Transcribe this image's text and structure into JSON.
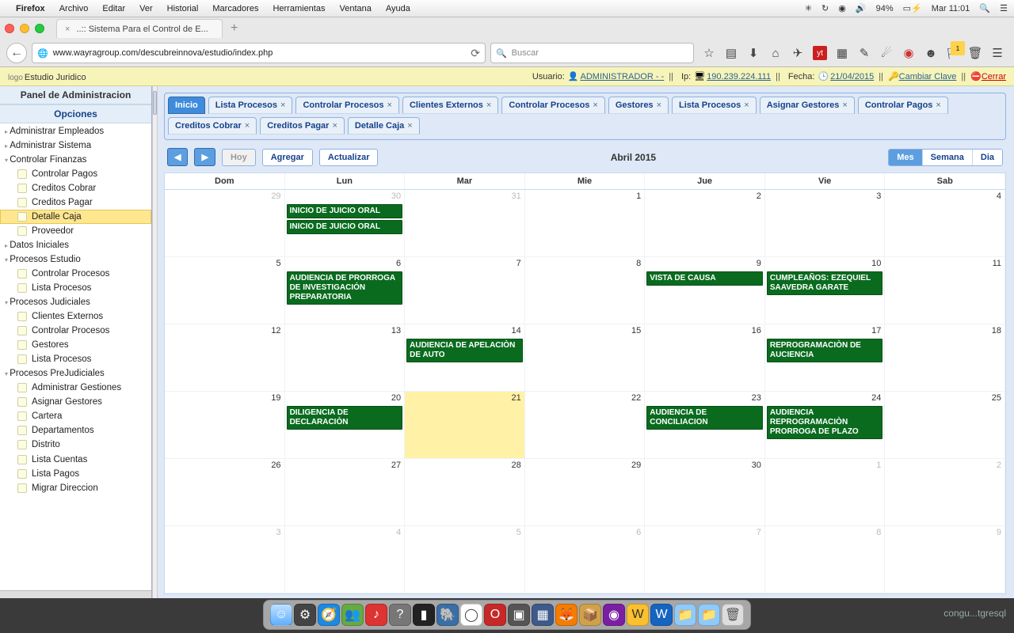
{
  "mac_menu": {
    "app": "Firefox",
    "items": [
      "Archivo",
      "Editar",
      "Ver",
      "Historial",
      "Marcadores",
      "Herramientas",
      "Ventana",
      "Ayuda"
    ],
    "status": {
      "battery": "94%",
      "time": "Mar 11:01"
    }
  },
  "browser": {
    "tab_title": "..:: Sistema Para el Control de E...",
    "url": "www.wayragroup.com/descubreinnova/estudio/index.php",
    "search_placeholder": "Buscar"
  },
  "app_header": {
    "logo_prefix": "logo",
    "logo_text": "Estudio Juridico",
    "usuario_label": "Usuario:",
    "usuario": "ADMINISTRADOR - -",
    "ip_label": "Ip:",
    "ip": "190.239.224.111",
    "fecha_label": "Fecha:",
    "fecha": "21/04/2015",
    "cambiar": "Cambiar Clave",
    "cerrar": "Cerrar"
  },
  "sidebar": {
    "title": "Panel de Administracion",
    "subtitle": "Opciones",
    "nodes": [
      {
        "label": "Administrar Empleados",
        "type": "parent",
        "open": false
      },
      {
        "label": "Administrar Sistema",
        "type": "parent",
        "open": false
      },
      {
        "label": "Controlar Finanzas",
        "type": "parent",
        "open": true
      },
      {
        "label": "Controlar Pagos",
        "type": "child"
      },
      {
        "label": "Creditos Cobrar",
        "type": "child"
      },
      {
        "label": "Creditos Pagar",
        "type": "child"
      },
      {
        "label": "Detalle Caja",
        "type": "child",
        "selected": true
      },
      {
        "label": "Proveedor",
        "type": "child"
      },
      {
        "label": "Datos Iniciales",
        "type": "parent",
        "open": false
      },
      {
        "label": "Procesos Estudio",
        "type": "parent",
        "open": true
      },
      {
        "label": "Controlar Procesos",
        "type": "child"
      },
      {
        "label": "Lista Procesos",
        "type": "child"
      },
      {
        "label": "Procesos Judiciales",
        "type": "parent",
        "open": true
      },
      {
        "label": "Clientes Externos",
        "type": "child"
      },
      {
        "label": "Controlar Procesos",
        "type": "child"
      },
      {
        "label": "Gestores",
        "type": "child"
      },
      {
        "label": "Lista Procesos",
        "type": "child"
      },
      {
        "label": "Procesos PreJudiciales",
        "type": "parent",
        "open": true
      },
      {
        "label": "Administrar Gestiones",
        "type": "child"
      },
      {
        "label": "Asignar Gestores",
        "type": "child"
      },
      {
        "label": "Cartera",
        "type": "child"
      },
      {
        "label": "Departamentos",
        "type": "child"
      },
      {
        "label": "Distrito",
        "type": "child"
      },
      {
        "label": "Lista Cuentas",
        "type": "child"
      },
      {
        "label": "Lista Pagos",
        "type": "child"
      },
      {
        "label": "Migrar Direccion",
        "type": "child"
      }
    ]
  },
  "tabs": [
    {
      "label": "Inicio",
      "active": true,
      "closable": false
    },
    {
      "label": "Lista Procesos",
      "closable": true
    },
    {
      "label": "Controlar Procesos",
      "closable": true
    },
    {
      "label": "Clientes Externos",
      "closable": true
    },
    {
      "label": "Controlar Procesos",
      "closable": true
    },
    {
      "label": "Gestores",
      "closable": true
    },
    {
      "label": "Lista Procesos",
      "closable": true
    },
    {
      "label": "Asignar Gestores",
      "closable": true
    },
    {
      "label": "Controlar Pagos",
      "closable": true
    },
    {
      "label": "Creditos Cobrar",
      "closable": true
    },
    {
      "label": "Creditos Pagar",
      "closable": true
    },
    {
      "label": "Detalle Caja",
      "closable": true
    }
  ],
  "calendar": {
    "toolbar": {
      "hoy": "Hoy",
      "agregar": "Agregar",
      "actualizar": "Actualizar"
    },
    "title": "Abril 2015",
    "views": {
      "mes": "Mes",
      "semana": "Semana",
      "dia": "Dia"
    },
    "dow": [
      "Dom",
      "Lun",
      "Mar",
      "Mie",
      "Jue",
      "Vie",
      "Sab"
    ],
    "weeks": [
      [
        {
          "n": "29",
          "other": true
        },
        {
          "n": "30",
          "other": true,
          "events": [
            "INICIO DE JUICIO ORAL",
            "INICIO DE JUICIO ORAL"
          ]
        },
        {
          "n": "31",
          "other": true
        },
        {
          "n": "1"
        },
        {
          "n": "2"
        },
        {
          "n": "3"
        },
        {
          "n": "4"
        }
      ],
      [
        {
          "n": "5"
        },
        {
          "n": "6",
          "events": [
            "AUDIENCIA DE PRORROGA DE INVESTIGACIÓN PREPARATORIA"
          ]
        },
        {
          "n": "7"
        },
        {
          "n": "8"
        },
        {
          "n": "9",
          "events": [
            "VISTA DE CAUSA"
          ]
        },
        {
          "n": "10",
          "events": [
            "CUMPLEAÑOS: EZEQUIEL SAAVEDRA GARATE"
          ]
        },
        {
          "n": "11"
        }
      ],
      [
        {
          "n": "12"
        },
        {
          "n": "13"
        },
        {
          "n": "14",
          "events": [
            "AUDIENCIA DE APELACIÒN DE AUTO"
          ]
        },
        {
          "n": "15"
        },
        {
          "n": "16"
        },
        {
          "n": "17",
          "events": [
            "REPROGRAMACIÒN DE AUCIENCIA"
          ]
        },
        {
          "n": "18"
        }
      ],
      [
        {
          "n": "19"
        },
        {
          "n": "20",
          "events": [
            "DILIGENCIA DE DECLARACIÒN"
          ]
        },
        {
          "n": "21",
          "today": true
        },
        {
          "n": "22"
        },
        {
          "n": "23",
          "events": [
            "AUDIENCIA DE CONCILIACION"
          ]
        },
        {
          "n": "24",
          "events": [
            "AUDIENCIA REPROGRAMACIÒN PRORROGA DE PLAZO"
          ]
        },
        {
          "n": "25"
        }
      ],
      [
        {
          "n": "26"
        },
        {
          "n": "27"
        },
        {
          "n": "28"
        },
        {
          "n": "29"
        },
        {
          "n": "30"
        },
        {
          "n": "1",
          "other": true
        },
        {
          "n": "2",
          "other": true
        }
      ],
      [
        {
          "n": "3",
          "other": true
        },
        {
          "n": "4",
          "other": true
        },
        {
          "n": "5",
          "other": true
        },
        {
          "n": "6",
          "other": true
        },
        {
          "n": "7",
          "other": true
        },
        {
          "n": "8",
          "other": true
        },
        {
          "n": "9",
          "other": true
        }
      ]
    ]
  },
  "faded_text": "congu...tgresql"
}
